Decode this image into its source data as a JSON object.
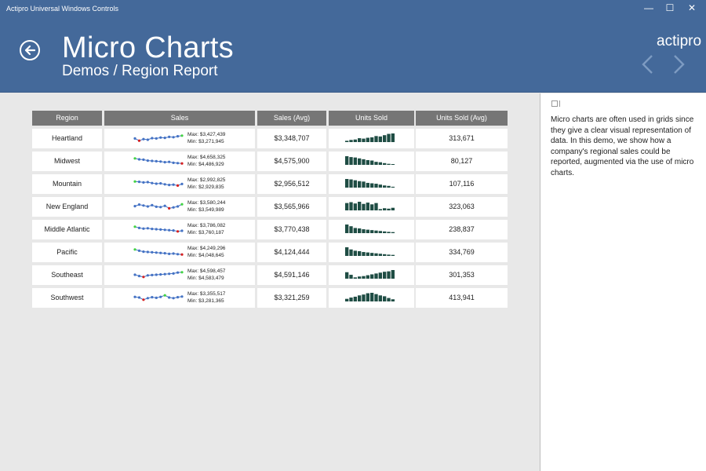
{
  "window": {
    "title": "Actipro Universal Windows Controls",
    "minimize_glyph": "—",
    "maximize_glyph": "☐",
    "close_glyph": "✕"
  },
  "header": {
    "title": "Micro Charts",
    "subtitle": "Demos / Region Report",
    "brand": "actipro"
  },
  "colors": {
    "header_bg": "#44699a",
    "grid_header": "#767676",
    "spark_line": "#4472c4",
    "spark_high": "#41d341",
    "spark_low": "#d61f1f",
    "bar_fill": "#1f4d44"
  },
  "icons": [
    "back-arrow-icon",
    "chevron-left-icon",
    "chevron-right-icon",
    "pane-icon"
  ],
  "grid": {
    "columns": [
      "Region",
      "Sales",
      "Sales (Avg)",
      "Units Sold",
      "Units Sold (Avg)"
    ],
    "rows": [
      {
        "region": "Heartland",
        "max": "Max: $3,427,439",
        "min": "Min: $3,271,945",
        "sales_avg": "$3,348,707",
        "units_avg": "313,671",
        "spark": [
          0.45,
          0.1,
          0.35,
          0.25,
          0.5,
          0.45,
          0.6,
          0.55,
          0.7,
          0.65,
          0.8,
          0.9
        ],
        "bars": [
          0.15,
          0.25,
          0.3,
          0.45,
          0.4,
          0.5,
          0.55,
          0.7,
          0.65,
          0.8,
          0.95,
          1.0
        ]
      },
      {
        "region": "Midwest",
        "max": "Max: $4,658,325",
        "min": "Min: $4,486,929",
        "sales_avg": "$4,575,900",
        "units_avg": "80,127",
        "spark": [
          0.9,
          0.75,
          0.7,
          0.55,
          0.5,
          0.45,
          0.4,
          0.3,
          0.35,
          0.2,
          0.15,
          0.1
        ],
        "bars": [
          1.0,
          0.9,
          0.85,
          0.75,
          0.65,
          0.55,
          0.5,
          0.35,
          0.3,
          0.2,
          0.12,
          0.08
        ]
      },
      {
        "region": "Mountain",
        "max": "Max: $2,992,825",
        "min": "Min: $2,929,835",
        "sales_avg": "$2,956,512",
        "units_avg": "107,116",
        "spark": [
          0.85,
          0.8,
          0.7,
          0.75,
          0.6,
          0.5,
          0.55,
          0.4,
          0.3,
          0.35,
          0.2,
          0.45
        ],
        "bars": [
          1.0,
          0.95,
          0.85,
          0.75,
          0.7,
          0.55,
          0.5,
          0.45,
          0.35,
          0.25,
          0.2,
          0.1
        ]
      },
      {
        "region": "New England",
        "max": "Max: $3,580,244",
        "min": "Min: $3,549,989",
        "sales_avg": "$3,565,966",
        "units_avg": "323,063",
        "spark": [
          0.55,
          0.8,
          0.65,
          0.5,
          0.7,
          0.45,
          0.4,
          0.6,
          0.2,
          0.35,
          0.5,
          0.85
        ],
        "bars": [
          0.85,
          0.95,
          0.8,
          1.0,
          0.75,
          0.9,
          0.7,
          0.85,
          0.15,
          0.25,
          0.2,
          0.3
        ]
      },
      {
        "region": "Middle Atlantic",
        "max": "Max: $3,786,082",
        "min": "Min: $3,760,187",
        "sales_avg": "$3,770,438",
        "units_avg": "238,837",
        "spark": [
          0.9,
          0.7,
          0.6,
          0.65,
          0.55,
          0.5,
          0.45,
          0.4,
          0.35,
          0.3,
          0.15,
          0.25
        ],
        "bars": [
          1.0,
          0.8,
          0.6,
          0.55,
          0.45,
          0.4,
          0.35,
          0.3,
          0.25,
          0.2,
          0.15,
          0.12
        ]
      },
      {
        "region": "Pacific",
        "max": "Max: $4,249,296",
        "min": "Min: $4,048,645",
        "sales_avg": "$4,124,444",
        "units_avg": "334,769",
        "spark": [
          0.9,
          0.7,
          0.55,
          0.5,
          0.45,
          0.4,
          0.35,
          0.3,
          0.2,
          0.25,
          0.15,
          0.1
        ],
        "bars": [
          1.0,
          0.75,
          0.6,
          0.55,
          0.45,
          0.4,
          0.35,
          0.3,
          0.25,
          0.2,
          0.15,
          0.12
        ]
      },
      {
        "region": "Southeast",
        "max": "Max: $4,598,457",
        "min": "Min: $4,583,479",
        "sales_avg": "$4,591,146",
        "units_avg": "301,353",
        "spark": [
          0.5,
          0.3,
          0.15,
          0.4,
          0.45,
          0.5,
          0.55,
          0.6,
          0.65,
          0.7,
          0.85,
          0.9
        ],
        "bars": [
          0.75,
          0.45,
          0.15,
          0.25,
          0.3,
          0.4,
          0.5,
          0.6,
          0.7,
          0.8,
          0.85,
          1.0
        ]
      },
      {
        "region": "Southwest",
        "max": "Max: $3,355,517",
        "min": "Min: $3,281,365",
        "sales_avg": "$3,321,259",
        "units_avg": "413,941",
        "spark": [
          0.6,
          0.5,
          0.15,
          0.4,
          0.55,
          0.45,
          0.6,
          0.85,
          0.5,
          0.4,
          0.55,
          0.65
        ],
        "bars": [
          0.3,
          0.45,
          0.55,
          0.7,
          0.8,
          0.95,
          1.0,
          0.85,
          0.7,
          0.6,
          0.4,
          0.25
        ]
      }
    ]
  },
  "description": "Micro charts are often used in grids since they give a clear visual representation of data. In this demo, we show how a company's regional sales could be reported, augmented via the use of micro charts."
}
